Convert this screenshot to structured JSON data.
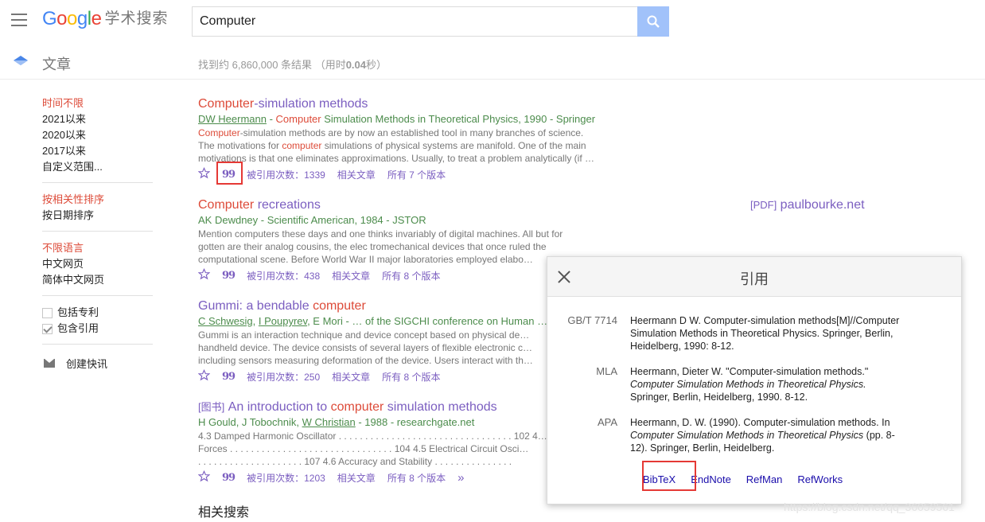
{
  "header": {
    "logo_letters": [
      "G",
      "o",
      "o",
      "g",
      "l",
      "e"
    ],
    "logo_suffix": "学术搜索",
    "search_value": "Computer"
  },
  "articles_label": "文章",
  "stats": {
    "prefix": "找到约 6,860,000 条结果",
    "time_prefix": "（用时",
    "time": "0.04",
    "time_suffix": "秒）"
  },
  "sidebar": {
    "time": [
      "时间不限",
      "2021以来",
      "2020以来",
      "2017以来",
      "自定义范围..."
    ],
    "sort": [
      "按相关性排序",
      "按日期排序"
    ],
    "lang": [
      "不限语言",
      "中文网页",
      "简体中文网页"
    ],
    "include_patents": "包括专利",
    "include_citations": "包含引用",
    "create_alert": "创建快讯"
  },
  "results": [
    {
      "title_hl": "Computer",
      "title_rest": "-simulation methods",
      "meta_author": "DW Heermann",
      "meta_sep": " - ",
      "meta_hl": "Computer",
      "meta_rest": " Simulation Methods in Theoretical Physics, 1990 - Springer",
      "snip1_hl": "Computer",
      "snip1_rest": "-simulation methods are by now an established tool in many branches of science.",
      "snip2_a": "The motivations for ",
      "snip2_hl": "computer",
      "snip2_b": " simulations of physical systems are manifold. One of the main",
      "snip3": "motivations is that one eliminates approximations. Usually, to treat a problem analytically (if …",
      "cited": "被引用次数：1339",
      "related": "相关文章",
      "versions": "所有 7 个版本"
    },
    {
      "title_hl": "Computer",
      "title_rest": " recreations",
      "meta": "AK Dewdney - Scientific American, 1984 - JSTOR",
      "snip1": "Mention computers these days and one thinks invariably of digital machines. All but for",
      "snip2": "gotten are their analog cousins, the elec tromechanical devices that once ruled the",
      "snip3": "computational scene. Before World War II major laboratories employed elabo…",
      "cited": "被引用次数：438",
      "related": "相关文章",
      "versions": "所有 8 个版本"
    },
    {
      "title_a": "Gummi: a bendable ",
      "title_hl": "computer",
      "meta_a1": "C Schwesig",
      "meta_c1": ", ",
      "meta_a2": "I Poupyrev",
      "meta_rest": ", E Mori - … of the SIGCHI conference on Human …",
      "snip1": "Gummi is an interaction technique and device concept based on physical de…",
      "snip2": "handheld device. The device consists of several layers of flexible electronic c…",
      "snip3": "including sensors measuring deformation of the device. Users interact with th…",
      "cited": "被引用次数：250",
      "related": "相关文章",
      "versions": "所有 8 个版本"
    },
    {
      "tag": "[图书]",
      "title_a": " An introduction to ",
      "title_hl": "computer",
      "title_b": " simulation methods",
      "meta_a": "H Gould, J Tobochnik, ",
      "meta_u": "W Christian",
      "meta_rest": " - 1988 - researchgate.net",
      "snip1": "4.3 Damped Harmonic Oscillator . . . . . . . . . . . . . . . . . . . . . . . . . . . . . . . . . 102 4…",
      "snip2": "Forces . . . . . . . . . . . . . . . . . . . . . . . . . . . . . . . 104 4.5 Electrical Circuit Osci…",
      "snip3": ". . . . . . . . . . . . . . . . . . . . 107 4.6 Accuracy and Stability . . . . . . . . . . . . . . .",
      "cited": "被引用次数：1203",
      "related": "相关文章",
      "versions": "所有 8 个版本"
    }
  ],
  "pdf_link": {
    "tag": "[PDF]",
    "site": " paulbourke.net"
  },
  "related_searches": "相关搜索",
  "quote_glyph": "99",
  "more_glyph": "»",
  "cite_dialog": {
    "title": "引用",
    "gbt_fmt": "GB/T 7714",
    "gbt_l1": "Heermann D W. Computer-simulation methods[M]//Computer",
    "gbt_l2": "Simulation Methods in Theoretical Physics. Springer, Berlin,",
    "gbt_l3": "Heidelberg, 1990: 8-12.",
    "mla_fmt": "MLA",
    "mla_l1": "Heermann, Dieter W. \"Computer-simulation methods.\"",
    "mla_l2": "Computer Simulation Methods in Theoretical Physics.",
    "mla_l3": "Springer, Berlin, Heidelberg, 1990. 8-12.",
    "apa_fmt": "APA",
    "apa_l1": "Heermann, D. W. (1990). Computer-simulation methods. In",
    "apa_l2_i": "Computer Simulation Methods in Theoretical Physics",
    "apa_l2_b": " (pp. 8-",
    "apa_l3": "12). Springer, Berlin, Heidelberg.",
    "exports": [
      "BibTeX",
      "EndNote",
      "RefMan",
      "RefWorks"
    ]
  },
  "watermark": "https://blog.csdn.net/qq_36059561"
}
